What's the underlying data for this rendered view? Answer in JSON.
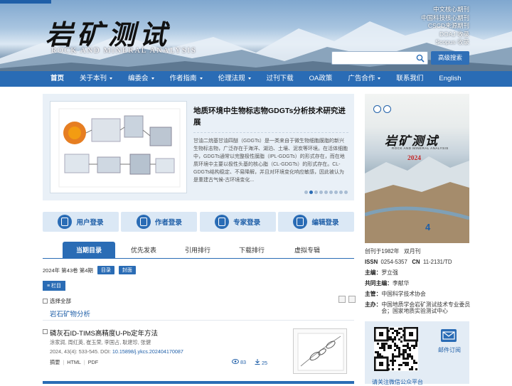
{
  "header": {
    "logo_cn": "岩矿测试",
    "logo_en": "ROCK AND MINERAL ANALYSIS",
    "badges": [
      "中文核心期刊",
      "中国科技核心期刊",
      "CSCD来源期刊",
      "DOAJ 收录",
      "Scopus 收录"
    ],
    "search": {
      "placeholder": ""
    },
    "advanced_search_label": "高级搜索"
  },
  "nav": {
    "items": [
      {
        "label": "首页",
        "dropdown": false
      },
      {
        "label": "关于本刊",
        "dropdown": true
      },
      {
        "label": "编委会",
        "dropdown": true
      },
      {
        "label": "作者指南",
        "dropdown": true
      },
      {
        "label": "伦理法规",
        "dropdown": true
      },
      {
        "label": "过刊下载",
        "dropdown": false
      },
      {
        "label": "OA政策",
        "dropdown": false
      },
      {
        "label": "广告合作",
        "dropdown": true
      },
      {
        "label": "联系我们",
        "dropdown": false
      },
      {
        "label": "English",
        "dropdown": false
      }
    ]
  },
  "feature": {
    "title": "地质环境中生物标志物GDGTs分析技术研究进展",
    "summary": "甘油二烷基甘油四醚（GDGTs）是一类来自于微生物细胞膜脂的新兴生物标志物，广泛存在于海洋、湖泊、土壤、泥炭等环境。在活体细胞中，GDGTs通常以完整极性膜脂（IPL-GDGTs）的形式存在，而在地质环境中主要以极性头基的核心脂（CL-GDGTs）的形式存在。CL-GDGTs结构稳定、不易降解，并且对环境变化响应敏感，因此被认为是重建古气候-古环境变化...",
    "dot_count": 9,
    "active_dot": 1
  },
  "login_buttons": [
    {
      "label": "用户登录"
    },
    {
      "label": "作者登录"
    },
    {
      "label": "专家登录"
    },
    {
      "label": "编辑登录"
    }
  ],
  "tabs": [
    {
      "label": "当期目录",
      "active": true
    },
    {
      "label": "优先发表",
      "active": false
    },
    {
      "label": "引用排行",
      "active": false
    },
    {
      "label": "下载排行",
      "active": false
    },
    {
      "label": "虚拟专辑",
      "active": false
    }
  ],
  "issue": {
    "text": "2024年 第43卷 第4期",
    "toc_label": "目录",
    "cover_label": "封面",
    "column_label": "≡ 栏目",
    "select_all_label": "选择全部",
    "section_title": "岩石矿物分析"
  },
  "article": {
    "title": "磷灰石ID-TIMS高精度U-Pb定年方法",
    "authors": "涂家润, 周红英, 崔玉荣, 李国占, 耿建珍, 张健",
    "citation": "2024, 43(4): 533-545. DOI: ",
    "doi": "10.15898/j.ykcs.202404170087",
    "links": [
      "摘要",
      "HTML",
      "PDF"
    ],
    "views": "83",
    "downloads": "25"
  },
  "cover": {
    "title_cn": "岩矿测试",
    "title_en": "ROCK AND MINERAL ANALYSIS",
    "year": "2024",
    "issue_num": "4"
  },
  "journal_info": {
    "founded": "创刊于1982年",
    "frequency": "双月刊",
    "issn_label": "ISSN",
    "issn": "0254-5357",
    "cn_label": "CN",
    "cn": "11-2131/TD",
    "editor_label": "主编：",
    "editor": "罗立强",
    "co_editor_label": "共同主编：",
    "co_editor": "李献华",
    "sponsor_label": "主管：",
    "sponsor": "中国科学技术协会",
    "organizer_label": "主办：",
    "organizer": "中国地质学会岩矿测试技术专业委员会；国家地质实验测试中心"
  },
  "sidebar_bottom": {
    "qr_caption": "请关注微信公众平台",
    "subscribe_label": "邮件订阅"
  },
  "colors": {
    "primary": "#2a6cb5",
    "nav_bg": "#2a6cb5",
    "light_panel": "#e9f0f7",
    "cover_year": "#c62828"
  }
}
